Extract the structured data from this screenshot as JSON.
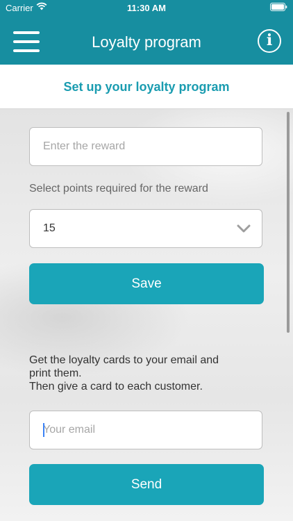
{
  "status_bar": {
    "carrier": "Carrier",
    "time": "11:30 AM"
  },
  "header": {
    "title": "Loyalty program",
    "menu_icon": "hamburger-icon",
    "info_icon": "info-icon",
    "info_glyph": "i"
  },
  "subheader": {
    "title": "Set up your loyalty program"
  },
  "form": {
    "reward_placeholder": "Enter the reward",
    "points_label": "Select points required for the reward",
    "points_value": "15",
    "save_label": "Save",
    "instructions": [
      "Get the loyalty cards to your email and",
      "print them.",
      "Then give a card to each customer."
    ],
    "email_placeholder": "Your email",
    "send_label": "Send"
  },
  "colors": {
    "brand": "#178ea0",
    "accent": "#1aa5b8",
    "title": "#1a9cb0"
  }
}
